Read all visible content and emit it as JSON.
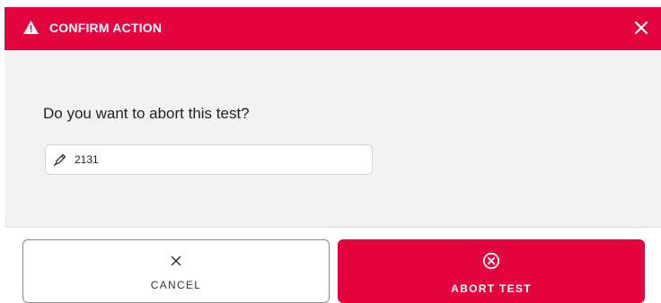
{
  "dialog": {
    "title": "CONFIRM ACTION",
    "title_icon": "warning-icon",
    "close_icon": "close-icon",
    "question": "Do you want to abort this test?",
    "test_field": {
      "icon": "pen-icon",
      "value": "2131"
    }
  },
  "footer": {
    "cancel": {
      "label": "CANCEL",
      "icon": "close-icon"
    },
    "abort": {
      "label": "ABORT TEST",
      "icon": "circle-x-icon"
    }
  },
  "colors": {
    "accent": "#e4053f",
    "body_bg": "#f2f2f2",
    "text": "#222222"
  }
}
